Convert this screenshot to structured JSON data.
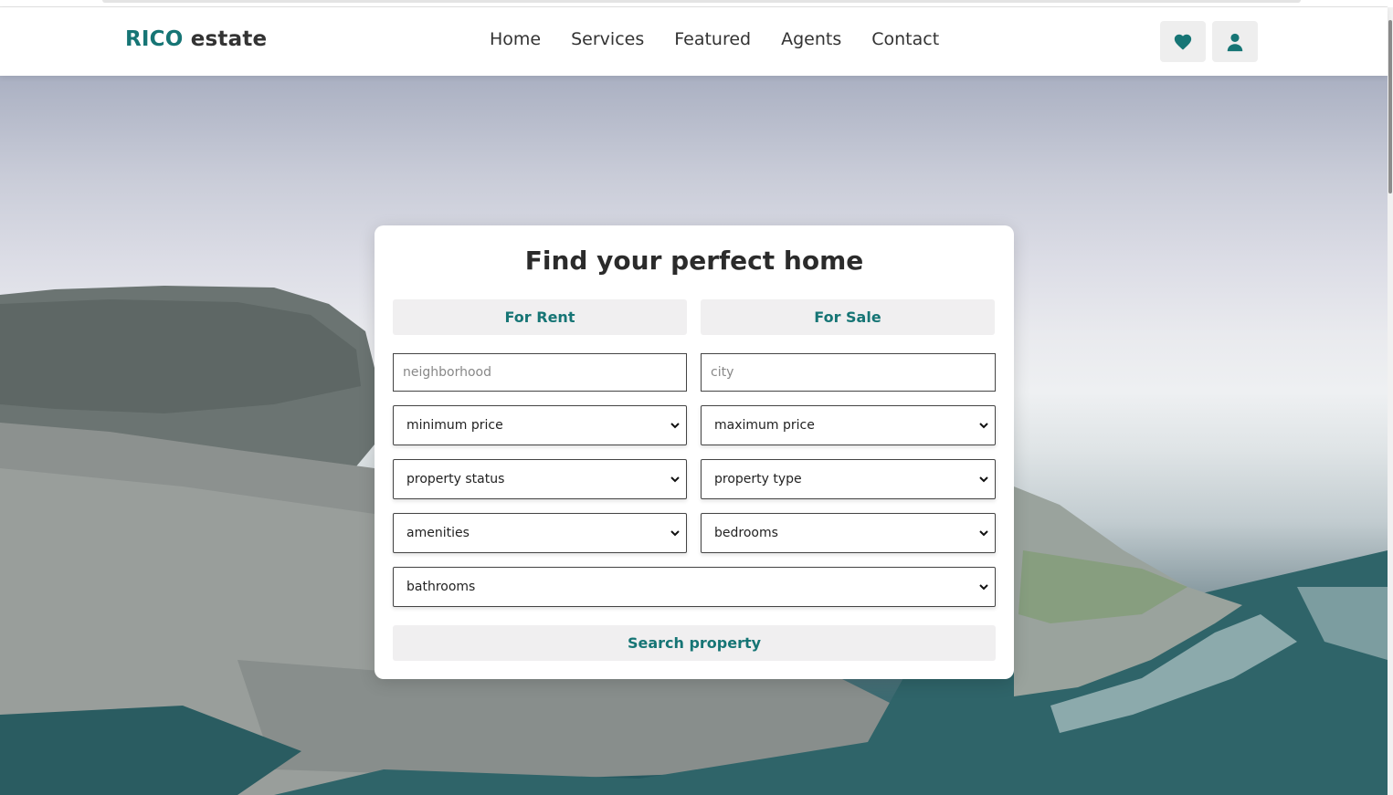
{
  "header": {
    "logo_accent": "RICO",
    "logo_rest": "estate",
    "nav": [
      "Home",
      "Services",
      "Featured",
      "Agents",
      "Contact"
    ],
    "icons": [
      "heart-icon",
      "user-icon"
    ]
  },
  "search_card": {
    "title": "Find your perfect home",
    "tabs": [
      "For Rent",
      "For Sale"
    ],
    "neighborhood_placeholder": "neighborhood",
    "city_placeholder": "city",
    "min_price": "minimum price",
    "max_price": "maximum price",
    "property_status": "property status",
    "property_type": "property type",
    "amenities": "amenities",
    "bedrooms": "bedrooms",
    "bathrooms": "bathrooms",
    "search_button": "Search property"
  },
  "colors": {
    "accent": "#167575",
    "button_bg": "#f0eff0"
  }
}
